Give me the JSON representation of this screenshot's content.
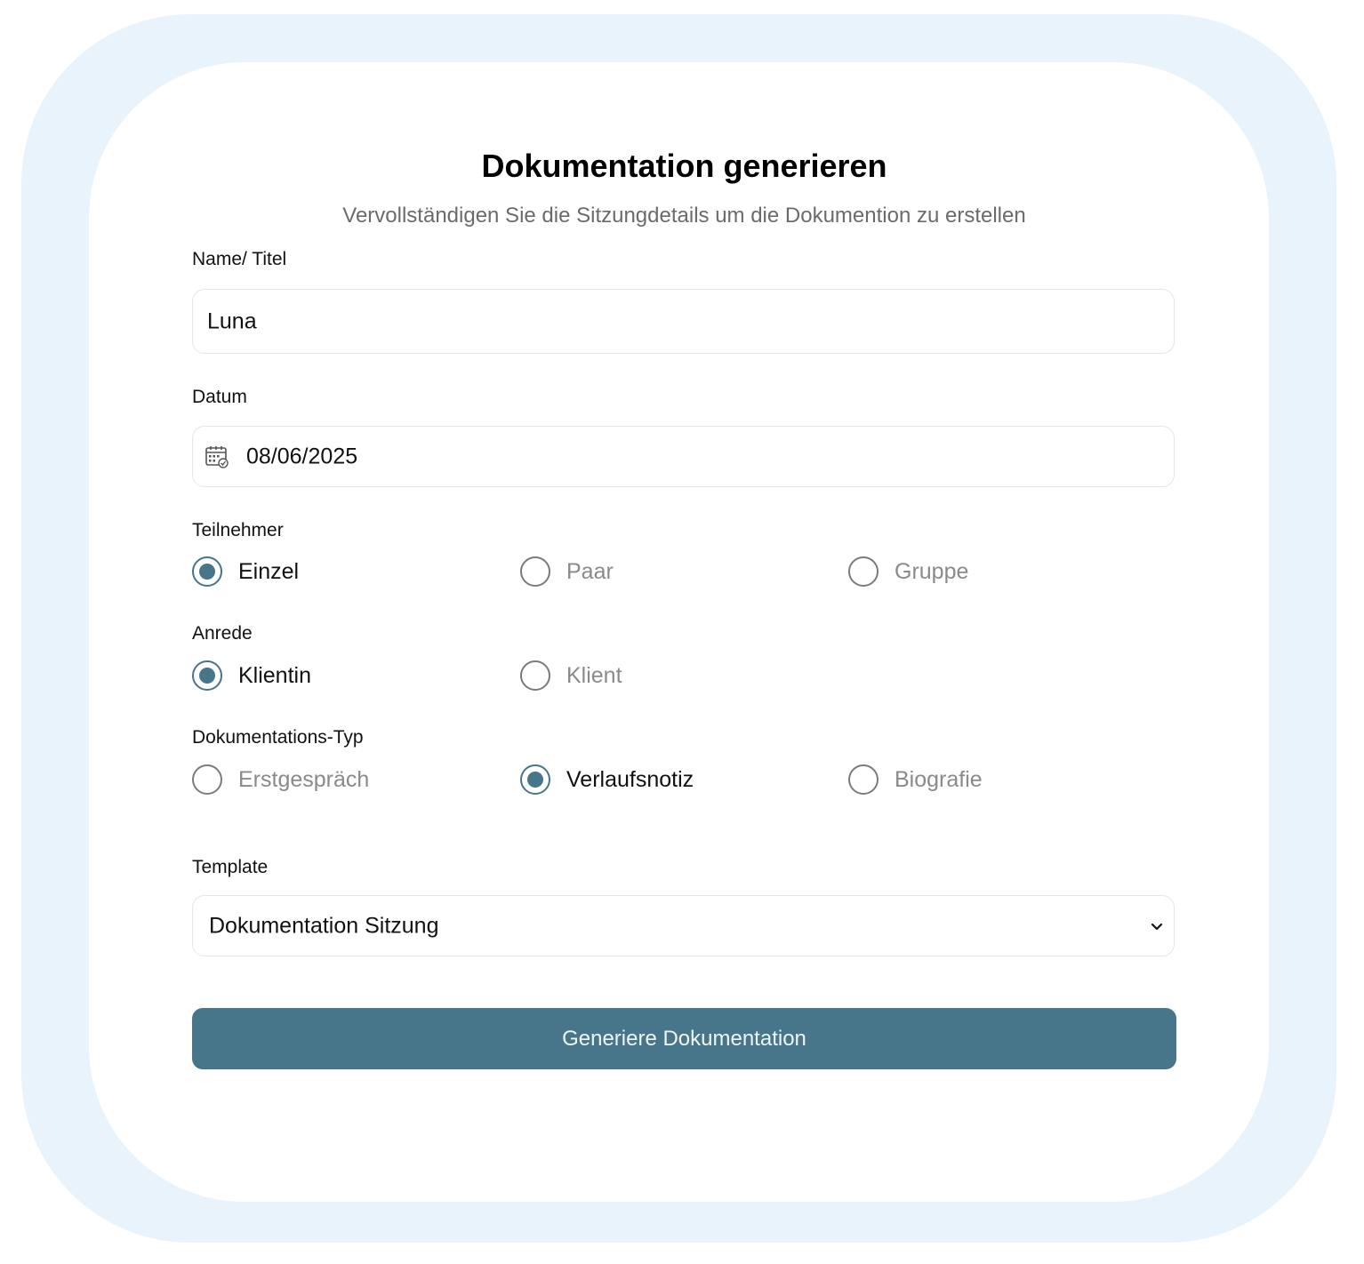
{
  "title": "Dokumentation generieren",
  "subtitle": "Vervollständigen Sie die Sitzungdetails um die Dokumention zu erstellen",
  "name_field": {
    "label": "Name/ Titel",
    "value": "Luna"
  },
  "date_field": {
    "label": "Datum",
    "value": "08/06/2025",
    "icon": "calendar-icon"
  },
  "participants": {
    "label": "Teilnehmer",
    "options": [
      {
        "label": "Einzel",
        "checked": true
      },
      {
        "label": "Paar",
        "checked": false
      },
      {
        "label": "Gruppe",
        "checked": false
      }
    ]
  },
  "salutation": {
    "label": "Anrede",
    "options": [
      {
        "label": "Klientin",
        "checked": true
      },
      {
        "label": "Klient",
        "checked": false
      }
    ]
  },
  "doc_type": {
    "label": "Dokumentations-Typ",
    "options": [
      {
        "label": "Erstgespräch",
        "checked": false
      },
      {
        "label": "Verlaufsnotiz",
        "checked": true
      },
      {
        "label": "Biografie",
        "checked": false
      }
    ]
  },
  "template": {
    "label": "Template",
    "selected": "Dokumentation Sitzung",
    "icon": "chevron-down-icon"
  },
  "submit": {
    "label": "Generiere Dokumentation"
  },
  "colors": {
    "accent": "#47758a",
    "frame": "#e9f3fc",
    "muted_text": "#8a8a8a"
  }
}
